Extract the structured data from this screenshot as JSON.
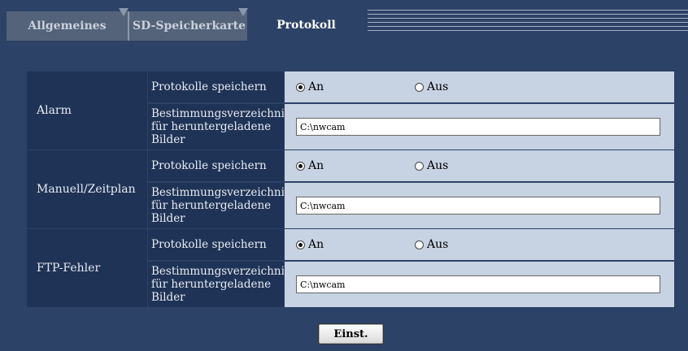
{
  "tabs": [
    {
      "label": "Allgemeines",
      "active": false
    },
    {
      "label": "SD-Speicherkarte",
      "active": false
    },
    {
      "label": "Protokoll",
      "active": true
    }
  ],
  "groups": [
    {
      "title": "Alarm",
      "save_label": "Protokolle speichern",
      "on_label": "An",
      "off_label": "Aus",
      "selected": "An",
      "dest_label": "Bestimmungsverzeichnis für heruntergeladene Bilder",
      "dest_value": "C:\\nwcam"
    },
    {
      "title": "Manuell/Zeitplan",
      "save_label": "Protokolle speichern",
      "on_label": "An",
      "off_label": "Aus",
      "selected": "An",
      "dest_label": "Bestimmungsverzeichnis für heruntergeladene Bilder",
      "dest_value": "C:\\nwcam"
    },
    {
      "title": "FTP-Fehler",
      "save_label": "Protokolle speichern",
      "on_label": "An",
      "off_label": "Aus",
      "selected": "An",
      "dest_label": "Bestimmungsverzeichnis für heruntergeladene Bilder",
      "dest_value": "C:\\nwcam"
    }
  ],
  "submit_label": "Einst.",
  "colors": {
    "background": "#2c4266",
    "label_bg": "#1f3356",
    "value_bg": "#c7d2e2"
  }
}
